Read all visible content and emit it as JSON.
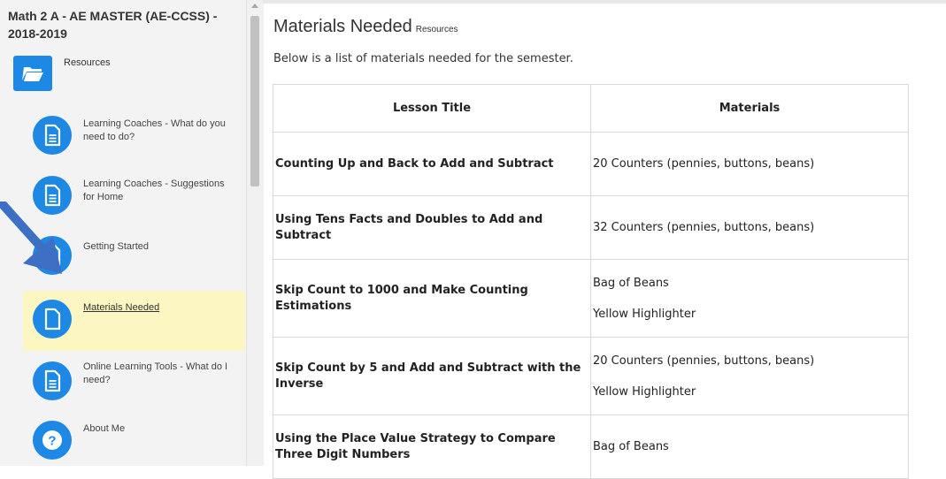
{
  "sidebar": {
    "course_title": "Math 2 A - AE MASTER (AE-CCSS) - 2018-2019",
    "section_label": "Resources",
    "section_icon": "folder-open-icon",
    "items": [
      {
        "label": "Learning Coaches - What do you need to do?",
        "icon": "document-icon"
      },
      {
        "label": "Learning Coaches - Suggestions for Home",
        "icon": "document-icon"
      },
      {
        "label": "Getting Started",
        "icon": "document-icon"
      },
      {
        "label": "Materials Needed",
        "icon": "document-icon",
        "active": true
      },
      {
        "label": "Online Learning Tools - What do I need?",
        "icon": "document-icon"
      },
      {
        "label": "About Me",
        "icon": "help-icon"
      }
    ]
  },
  "main": {
    "title": "Materials Needed",
    "subtitle": "Resources",
    "intro": "Below is a list of materials needed for the semester.",
    "table": {
      "headers": [
        "Lesson Title",
        "Materials"
      ],
      "rows": [
        {
          "title": "Counting Up and Back to Add and Subtract",
          "materials": [
            "20 Counters (pennies, buttons, beans)"
          ]
        },
        {
          "title": "Using Tens Facts and Doubles to Add and Subtract",
          "materials": [
            "32 Counters (pennies, buttons, beans)"
          ]
        },
        {
          "title": "Skip Count to 1000 and Make Counting Estimations",
          "materials": [
            "Bag of Beans",
            "Yellow Highlighter"
          ]
        },
        {
          "title": "Skip Count by 5 and Add and Subtract with the Inverse",
          "materials": [
            "20 Counters (pennies, buttons, beans)",
            "Yellow Highlighter"
          ]
        },
        {
          "title": "Using the Place Value Strategy to Compare Three Digit Numbers",
          "materials": [
            "Bag of Beans"
          ]
        }
      ]
    }
  },
  "colors": {
    "accent": "#1e88e5",
    "active_bg": "#fcf7c2",
    "arrow": "#3d6fc4",
    "sidebar_bg": "#f3f3f3"
  }
}
